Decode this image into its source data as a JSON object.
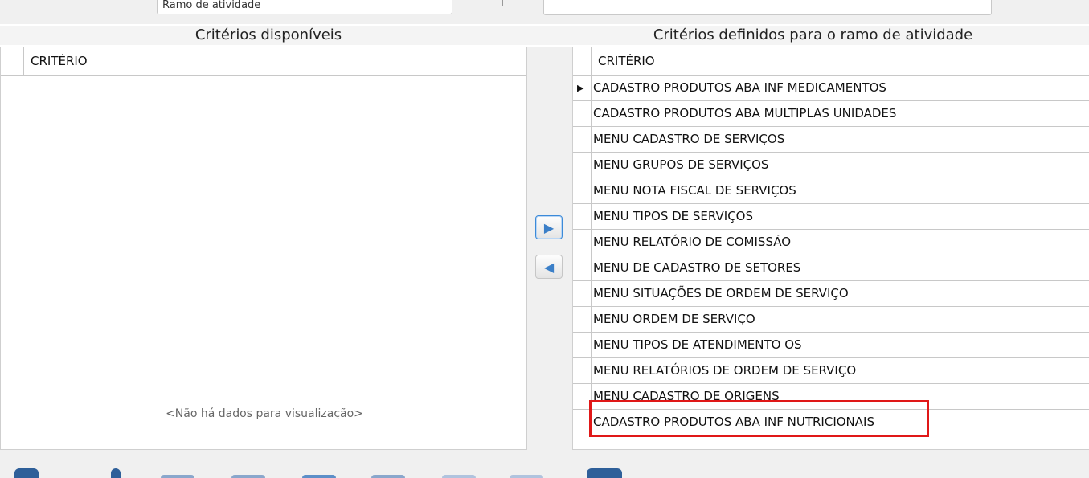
{
  "top_field_left": "Ramo de atividade",
  "left_panel": {
    "title": "Critérios disponíveis",
    "column_header": "CRITÉRIO",
    "empty_message": "<Não há dados para visualização>"
  },
  "right_panel": {
    "title": "Critérios definidos para o ramo de atividade",
    "column_header": "CRITÉRIO",
    "rows": [
      "CADASTRO PRODUTOS ABA INF MEDICAMENTOS",
      "CADASTRO PRODUTOS ABA MULTIPLAS UNIDADES",
      "MENU CADASTRO DE SERVIÇOS",
      "MENU GRUPOS DE SERVIÇOS",
      "MENU NOTA FISCAL DE SERVIÇOS",
      "MENU TIPOS DE SERVIÇOS",
      "MENU RELATÓRIO DE COMISSÃO",
      "MENU DE CADASTRO DE SETORES",
      "MENU SITUAÇÕES DE ORDEM DE SERVIÇO",
      "MENU ORDEM DE SERVIÇO",
      "MENU TIPOS DE ATENDIMENTO OS",
      "MENU RELATÓRIOS DE ORDEM DE SERVIÇO",
      "MENU CADASTRO DE ORIGENS",
      "CADASTRO PRODUTOS ABA INF NUTRICIONAIS"
    ],
    "selected_row_index": 0,
    "highlighted_row_index": 13
  },
  "buttons": {
    "move_right_icon": "▶",
    "move_left_icon": "◀"
  },
  "colors": {
    "highlight": "#e01818",
    "button_accent": "#3b7fc8"
  }
}
